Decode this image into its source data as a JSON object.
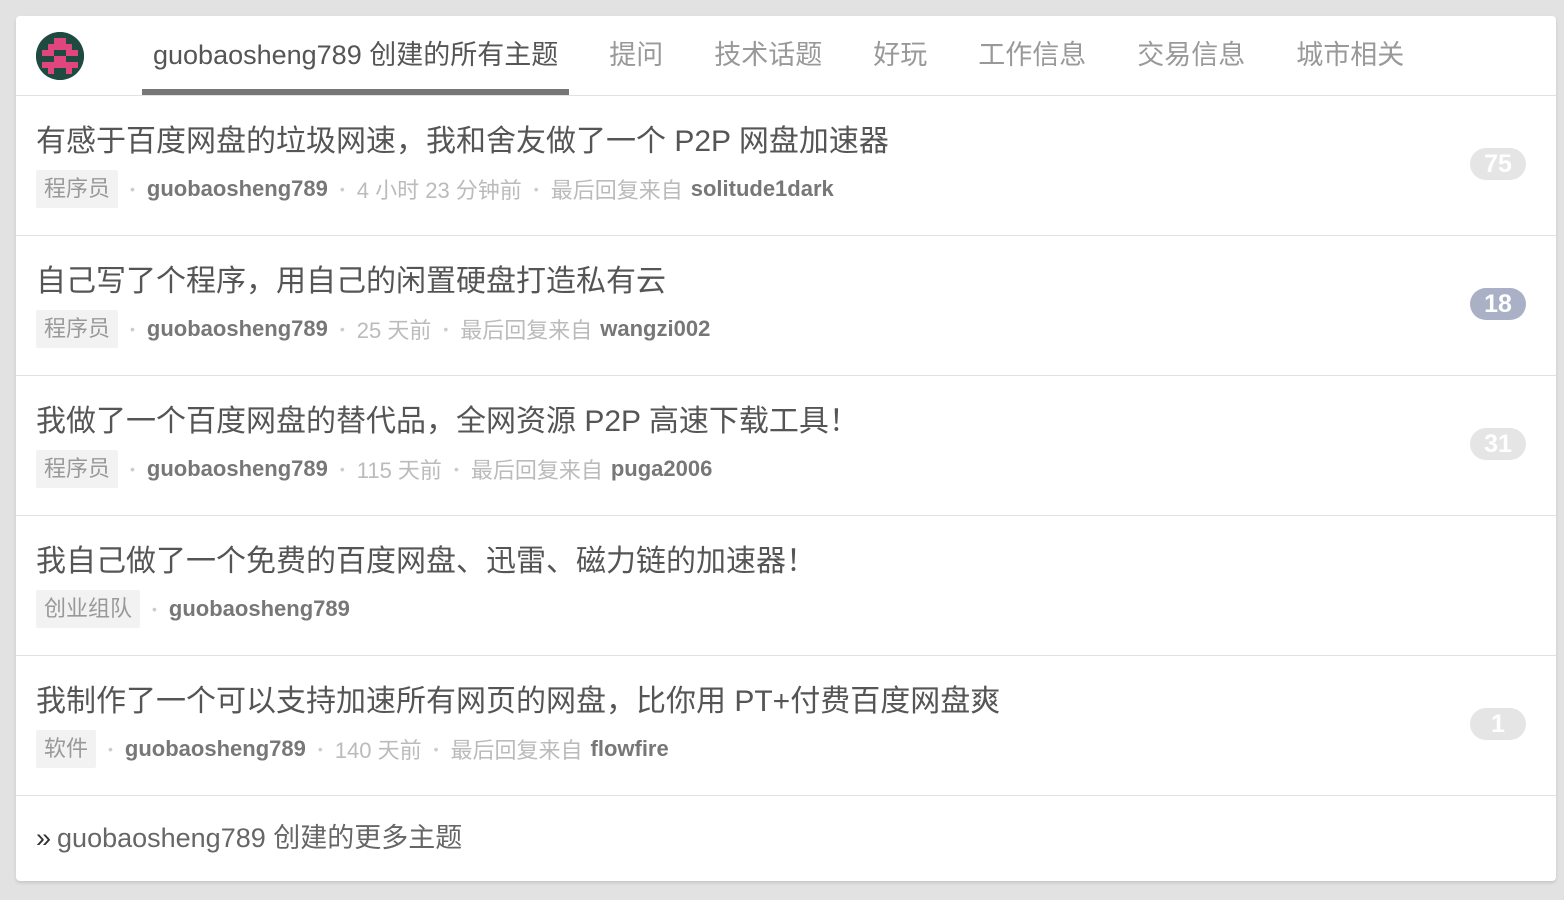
{
  "tabs": [
    {
      "label": "guobaosheng789 创建的所有主题",
      "active": true
    },
    {
      "label": "提问"
    },
    {
      "label": "技术话题"
    },
    {
      "label": "好玩"
    },
    {
      "label": "工作信息"
    },
    {
      "label": "交易信息"
    },
    {
      "label": "城市相关"
    }
  ],
  "avatar_colors": {
    "bg": "#1f4a3f",
    "fg": "#e0457b"
  },
  "topics": [
    {
      "title": "有感于百度网盘的垃圾网速，我和舍友做了一个 P2P 网盘加速器",
      "node": "程序员",
      "author": "guobaosheng789",
      "time": "4 小时 23 分钟前",
      "reply_prefix": "最后回复来自",
      "last_replier": "solitude1dark",
      "replies": "75"
    },
    {
      "title": "自己写了个程序，用自己的闲置硬盘打造私有云",
      "node": "程序员",
      "author": "guobaosheng789",
      "time": "25 天前",
      "reply_prefix": "最后回复来自",
      "last_replier": "wangzi002",
      "replies": "18"
    },
    {
      "title": "我做了一个百度网盘的替代品，全网资源 P2P 高速下载工具！",
      "node": "程序员",
      "author": "guobaosheng789",
      "time": "115 天前",
      "reply_prefix": "最后回复来自",
      "last_replier": "puga2006",
      "replies": "31"
    },
    {
      "title": "我自己做了一个免费的百度网盘、迅雷、磁力链的加速器！",
      "node": "创业组队",
      "author": "guobaosheng789"
    },
    {
      "title": "我制作了一个可以支持加速所有网页的网盘，比你用 PT+付费百度网盘爽",
      "node": "软件",
      "author": "guobaosheng789",
      "time": "140 天前",
      "reply_prefix": "最后回复来自",
      "last_replier": "flowfire",
      "replies": "1"
    }
  ],
  "more": {
    "raquo": "»",
    "label": "guobaosheng789 创建的更多主题"
  }
}
